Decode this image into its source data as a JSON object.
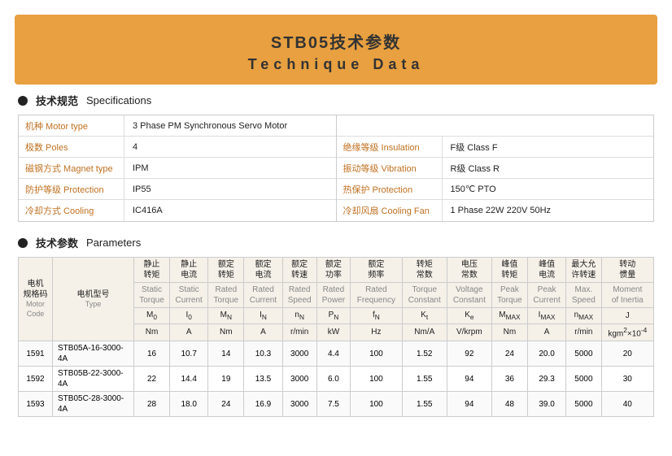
{
  "header": {
    "title_cn": "STB05技术参数",
    "title_en": "Technique Data"
  },
  "specs_section": {
    "heading_cn": "技术规范",
    "heading_en": "Specifications",
    "left_rows": [
      {
        "label": "机种 Motor type",
        "value": "3 Phase PM Synchronous Servo Motor"
      },
      {
        "label": "极数 Poles",
        "value": "4"
      },
      {
        "label": "磁钢方式 Magnet type",
        "value": "IPM"
      },
      {
        "label": "防护等级 Protection",
        "value": "IP55"
      },
      {
        "label": "冷却方式 Cooling",
        "value": "IC416A"
      }
    ],
    "right_rows": [
      {
        "label": "绝缘等级 Insulation",
        "value": "F级  Class F"
      },
      {
        "label": "振动等级 Vibration",
        "value": "R级  Class R"
      },
      {
        "label": "热保护 Protection",
        "value": "150℃ PTO"
      },
      {
        "label": "冷却风扇 Cooling Fan",
        "value": "1 Phase  22W  220V  50Hz"
      }
    ]
  },
  "params_section": {
    "heading_cn": "技术参数",
    "heading_en": "Parameters",
    "columns": [
      {
        "cn": "电机规格码",
        "en": "Motor Code",
        "sub": ""
      },
      {
        "cn": "电机型号",
        "en": "Type",
        "sub": ""
      },
      {
        "cn": "静止转矩",
        "en": "Static Torque",
        "sub": "M₀",
        "unit": "Nm"
      },
      {
        "cn": "静止电流",
        "en": "Static Current",
        "sub": "I₀",
        "unit": "A"
      },
      {
        "cn": "额定转矩",
        "en": "Rated Torque",
        "sub": "Mₙ",
        "unit": "Nm"
      },
      {
        "cn": "额定电流",
        "en": "Rated Current",
        "sub": "Iₙ",
        "unit": "A"
      },
      {
        "cn": "额定转速",
        "en": "Rated Speed",
        "sub": "nₙ",
        "unit": "r/min"
      },
      {
        "cn": "额定功率",
        "en": "Rated Power",
        "sub": "Pₙ",
        "unit": "kW"
      },
      {
        "cn": "额定频率",
        "en": "Rated Frequency",
        "sub": "fₙ",
        "unit": "Hz"
      },
      {
        "cn": "转矩常数",
        "en": "Torque Constant",
        "sub": "Kt",
        "unit": "Nm/A"
      },
      {
        "cn": "电压常数",
        "en": "Voltage Constant",
        "sub": "Ke",
        "unit": "V/krpm"
      },
      {
        "cn": "峰值转矩",
        "en": "Peak Torque",
        "sub": "Mmax",
        "unit": "Nm"
      },
      {
        "cn": "峰值电流",
        "en": "Peak Current",
        "sub": "Imax",
        "unit": "A"
      },
      {
        "cn": "最大允许转速",
        "en": "Max. Speed",
        "sub": "nmax",
        "unit": "r/min"
      },
      {
        "cn": "转动惯量",
        "en": "Moment of Inertia",
        "sub": "J",
        "unit": "kgm²×10⁻⁴"
      }
    ],
    "rows": [
      {
        "code": "1591",
        "type": "STB05A-16-3000-4A",
        "m0": "16",
        "i0": "10.7",
        "mn": "14",
        "in": "10.3",
        "nn": "3000",
        "pn": "4.4",
        "fn": "100",
        "kt": "1.52",
        "ke": "92",
        "mmax": "24",
        "imax": "20.0",
        "nmax": "5000",
        "j": "20"
      },
      {
        "code": "1592",
        "type": "STB05B-22-3000-4A",
        "m0": "22",
        "i0": "14.4",
        "mn": "19",
        "in": "13.5",
        "nn": "3000",
        "pn": "6.0",
        "fn": "100",
        "kt": "1.55",
        "ke": "94",
        "mmax": "36",
        "imax": "29.3",
        "nmax": "5000",
        "j": "30"
      },
      {
        "code": "1593",
        "type": "STB05C-28-3000-4A",
        "m0": "28",
        "i0": "18.0",
        "mn": "24",
        "in": "16.9",
        "nn": "3000",
        "pn": "7.5",
        "fn": "100",
        "kt": "1.55",
        "ke": "94",
        "mmax": "48",
        "imax": "39.0",
        "nmax": "5000",
        "j": "40"
      }
    ]
  }
}
